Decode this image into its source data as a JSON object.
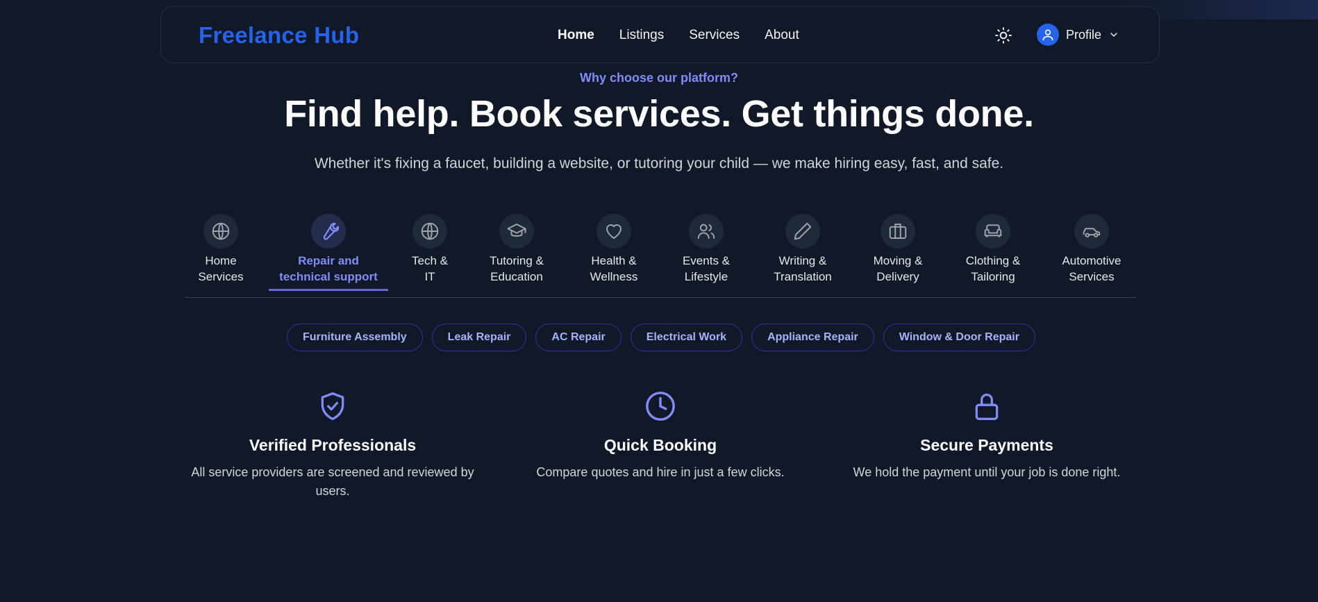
{
  "brand": "Freelance Hub",
  "nav": {
    "links": [
      "Home",
      "Listings",
      "Services",
      "About"
    ],
    "active": "Home",
    "profile_label": "Profile"
  },
  "hero": {
    "eyebrow": "Why choose our platform?",
    "title": "Find help. Book services. Get things done.",
    "subtitle": "Whether it's fixing a faucet, building a website, or tutoring your child — we make hiring easy, fast, and safe."
  },
  "categories": [
    {
      "label": "Home\nServices",
      "icon": "globe-icon"
    },
    {
      "label": "Repair and\ntechnical support",
      "icon": "wrench-icon",
      "active": true
    },
    {
      "label": "Tech &\nIT",
      "icon": "globe-icon"
    },
    {
      "label": "Tutoring &\nEducation",
      "icon": "graduation-cap-icon"
    },
    {
      "label": "Health &\nWellness",
      "icon": "heart-icon"
    },
    {
      "label": "Events &\nLifestyle",
      "icon": "users-icon"
    },
    {
      "label": "Writing &\nTranslation",
      "icon": "pencil-icon"
    },
    {
      "label": "Moving &\nDelivery",
      "icon": "briefcase-icon"
    },
    {
      "label": "Clothing &\nTailoring",
      "icon": "sofa-icon"
    },
    {
      "label": "Automotive\nServices",
      "icon": "car-icon"
    }
  ],
  "subcategories": [
    "Furniture Assembly",
    "Leak Repair",
    "AC Repair",
    "Electrical Work",
    "Appliance Repair",
    "Window & Door Repair"
  ],
  "features": [
    {
      "title": "Verified Professionals",
      "text": "All service providers are screened and reviewed by users.",
      "icon": "shield-check-icon"
    },
    {
      "title": "Quick Booking",
      "text": "Compare quotes and hire in just a few clicks.",
      "icon": "clock-icon"
    },
    {
      "title": "Secure Payments",
      "text": "We hold the payment until your job is done right.",
      "icon": "lock-icon"
    }
  ],
  "colors": {
    "background": "#111827",
    "brand": "#2563eb",
    "accent": "#818cf8",
    "accent_strong": "#6366f1"
  }
}
